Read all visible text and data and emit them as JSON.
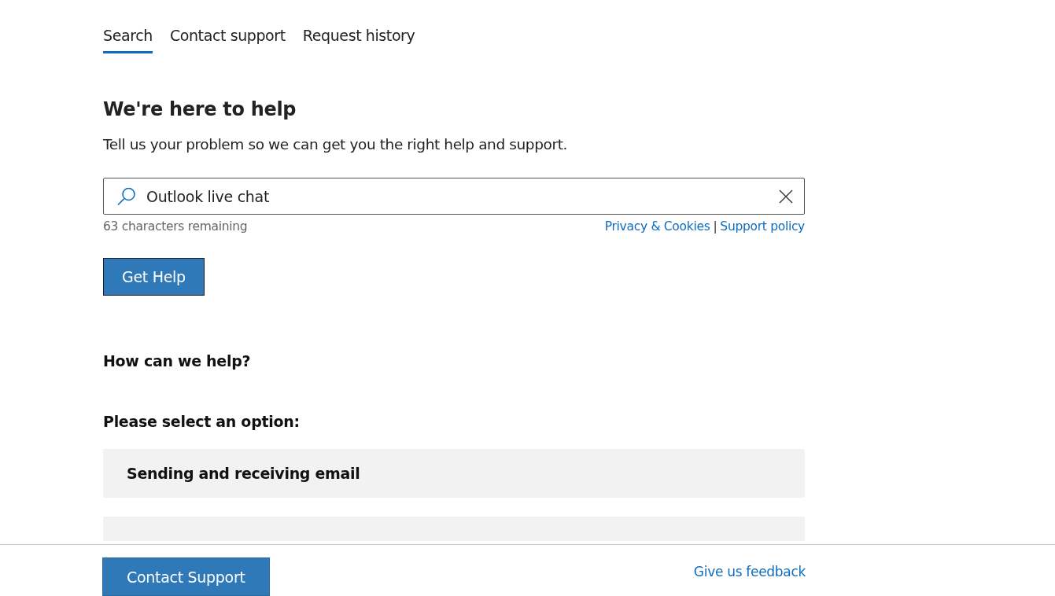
{
  "tabs": [
    {
      "label": "Search",
      "selected": true
    },
    {
      "label": "Contact support",
      "selected": false
    },
    {
      "label": "Request history",
      "selected": false
    }
  ],
  "heading": "We're here to help",
  "intro": "Tell us your problem so we can get you the right help and support.",
  "search": {
    "value": "Outlook live chat",
    "remaining": "63 characters remaining"
  },
  "links": [
    "Privacy & Cookies",
    "Support policy"
  ],
  "link_separator": "|",
  "get_help_button": "Get Help",
  "help_heading": "How can we help?",
  "options_heading": "Please select an option:",
  "options": [
    {
      "label": "Sending and receiving email",
      "cut_off": false
    },
    {
      "cut_off": true
    }
  ],
  "footer": {
    "button": "Contact Support",
    "feedback_link": "Give us feedback"
  }
}
